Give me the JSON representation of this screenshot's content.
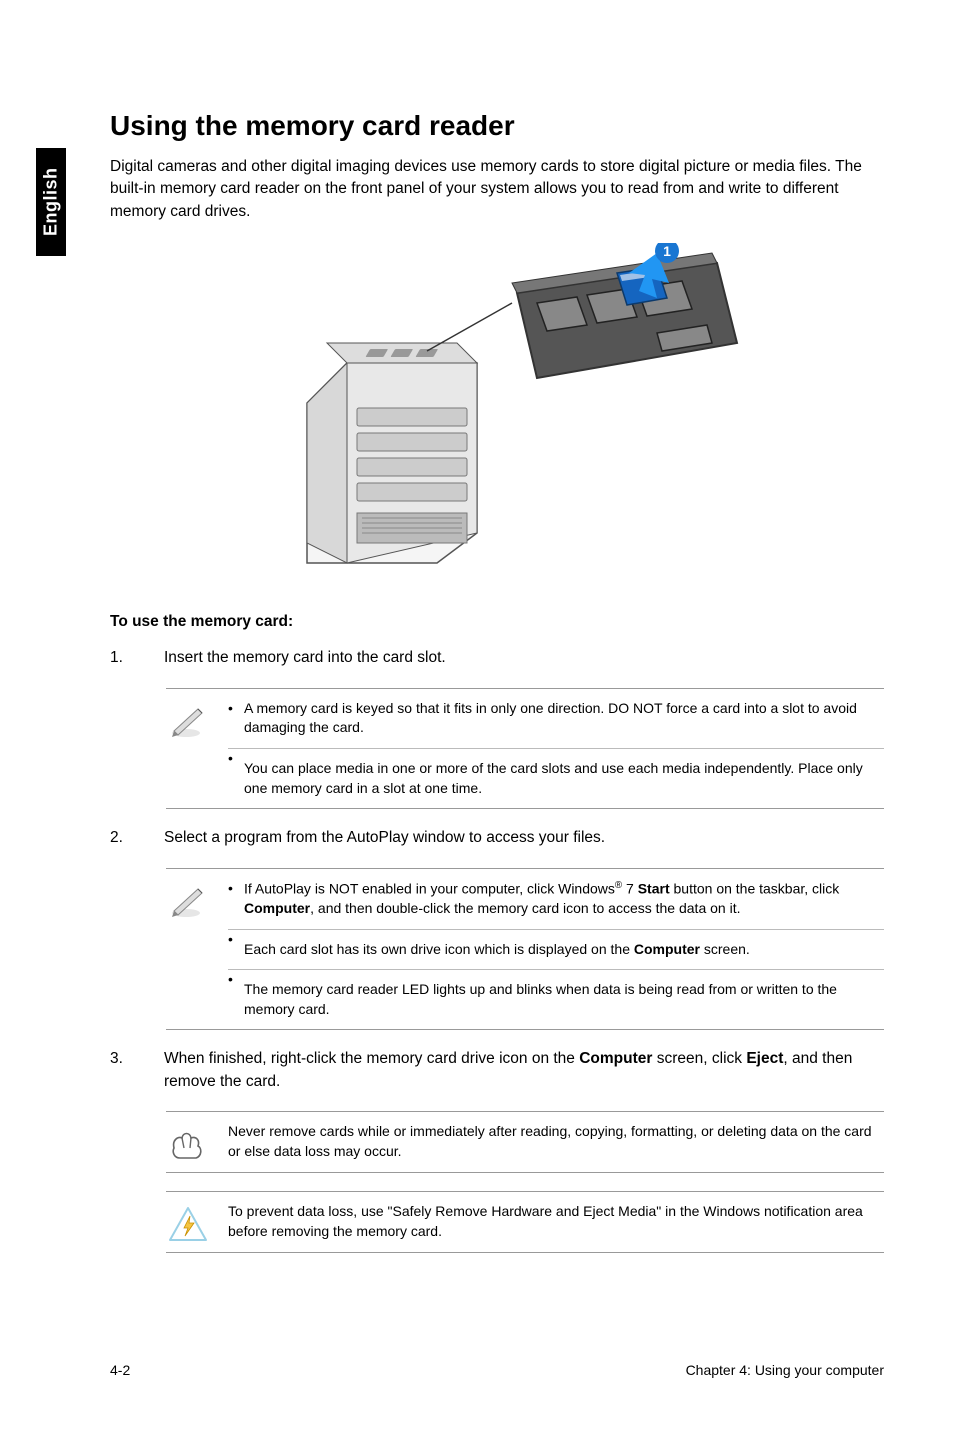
{
  "side_tab": "English",
  "title": "Using the memory card reader",
  "intro": "Digital cameras and other digital imaging devices use memory cards to store digital picture or media files. The built-in memory card reader on the front panel of your system allows you to read from and write to different memory card drives.",
  "figure": {
    "callout_number": "1"
  },
  "section_label": "To use the memory card:",
  "steps": [
    {
      "num": "1.",
      "text": "Insert the memory card into the card slot."
    },
    {
      "num": "2.",
      "text": "Select a program from the AutoPlay window to access your files."
    },
    {
      "num": "3.",
      "pre": "When finished, right-click the memory card drive icon on the ",
      "bold1": "Computer",
      "mid": " screen, click ",
      "bold2": "Eject",
      "post": ", and then remove the card."
    }
  ],
  "note1": {
    "items": [
      "A memory card is keyed so that it fits in only one direction. DO NOT force a card into a slot to avoid damaging the card.",
      "You can place media in one or more of the card slots and use each media independently. Place only one memory card in a slot at one time."
    ]
  },
  "note2": {
    "item1_pre": "If AutoPlay is NOT enabled in your computer, click Windows",
    "item1_sup": "®",
    "item1_mid1": " 7 ",
    "item1_bold1": "Start",
    "item1_mid2": " button on the taskbar, click ",
    "item1_bold2": "Computer",
    "item1_post": ", and then double-click the memory card icon to access the data on it.",
    "item2_pre": "Each card slot has its own drive icon which is displayed on the ",
    "item2_bold": "Computer",
    "item2_post": " screen.",
    "item3": "The memory card reader LED lights up and blinks when data is being read from or written to the memory card."
  },
  "note3": {
    "text": "Never remove cards while or immediately after reading, copying, formatting, or deleting data on the card or else data loss may occur."
  },
  "note4": {
    "text": "To prevent data loss, use \"Safely Remove Hardware and Eject Media\" in the Windows notification area before removing the memory card."
  },
  "footer": {
    "left": "4-2",
    "right": "Chapter 4: Using your computer"
  }
}
